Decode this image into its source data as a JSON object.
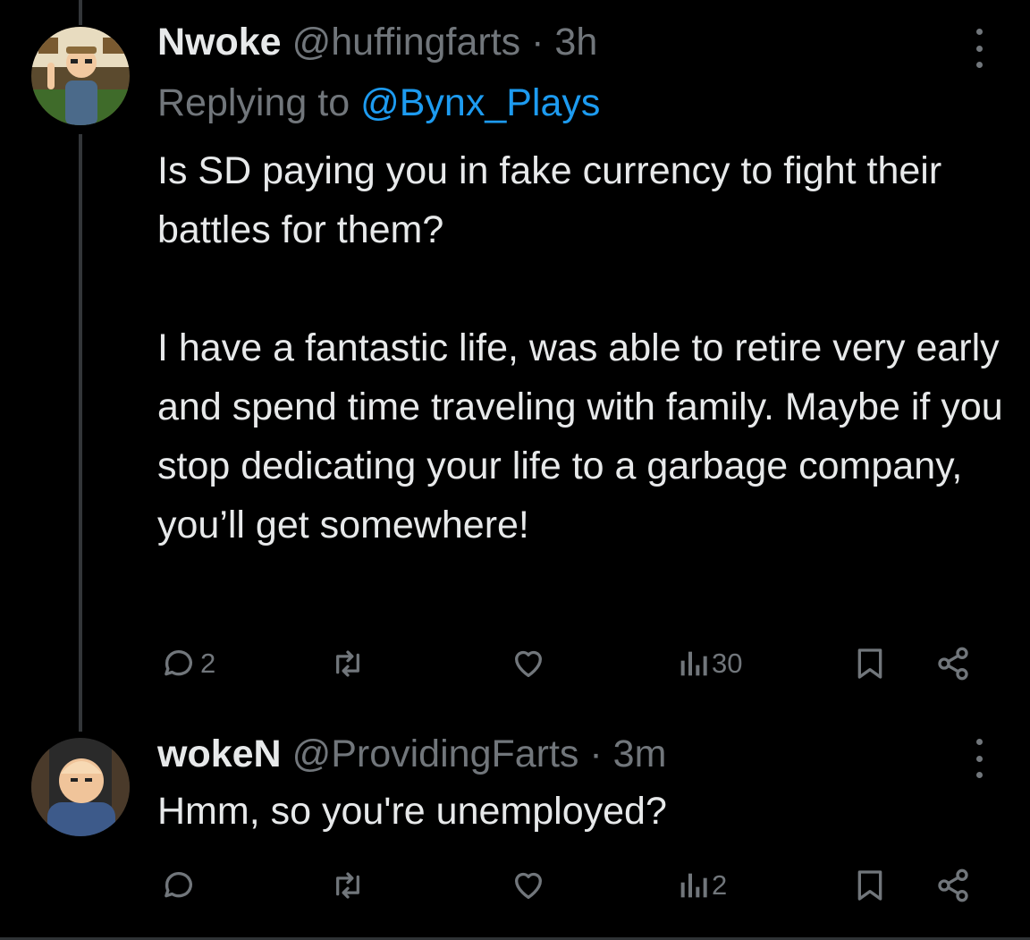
{
  "tweets": [
    {
      "display_name": "Nwoke",
      "handle": "@huffingfarts",
      "separator": "·",
      "time": "3h",
      "replying_prefix": "Replying to",
      "replying_handle": "@Bynx_Plays",
      "text_paragraphs": [
        "Is SD paying you in fake currency to fight their battles for them?",
        "I have a fantastic life, was able to retire very early and spend time traveling with family. Maybe if you stop dedicating your life to a garbage company, you’ll get somewhere!"
      ],
      "reply_count": "2",
      "views_count": "30"
    },
    {
      "display_name": "wokeN",
      "handle": "@ProvidingFarts",
      "separator": "·",
      "time": "3m",
      "text": "Hmm, so you're unemployed?",
      "views_count": "2"
    }
  ],
  "icons": {
    "reply": "speech-bubble-icon",
    "retweet": "retweet-arrows-icon",
    "like": "heart-outline-icon",
    "views": "bar-chart-icon",
    "bookmark": "bookmark-icon",
    "share": "share-nodes-icon",
    "more": "vertical-dots-icon"
  },
  "colors": {
    "background": "#000000",
    "text": "#e7e9ea",
    "muted": "#71767b",
    "link": "#1d9bf0",
    "thread_line": "#333639"
  }
}
